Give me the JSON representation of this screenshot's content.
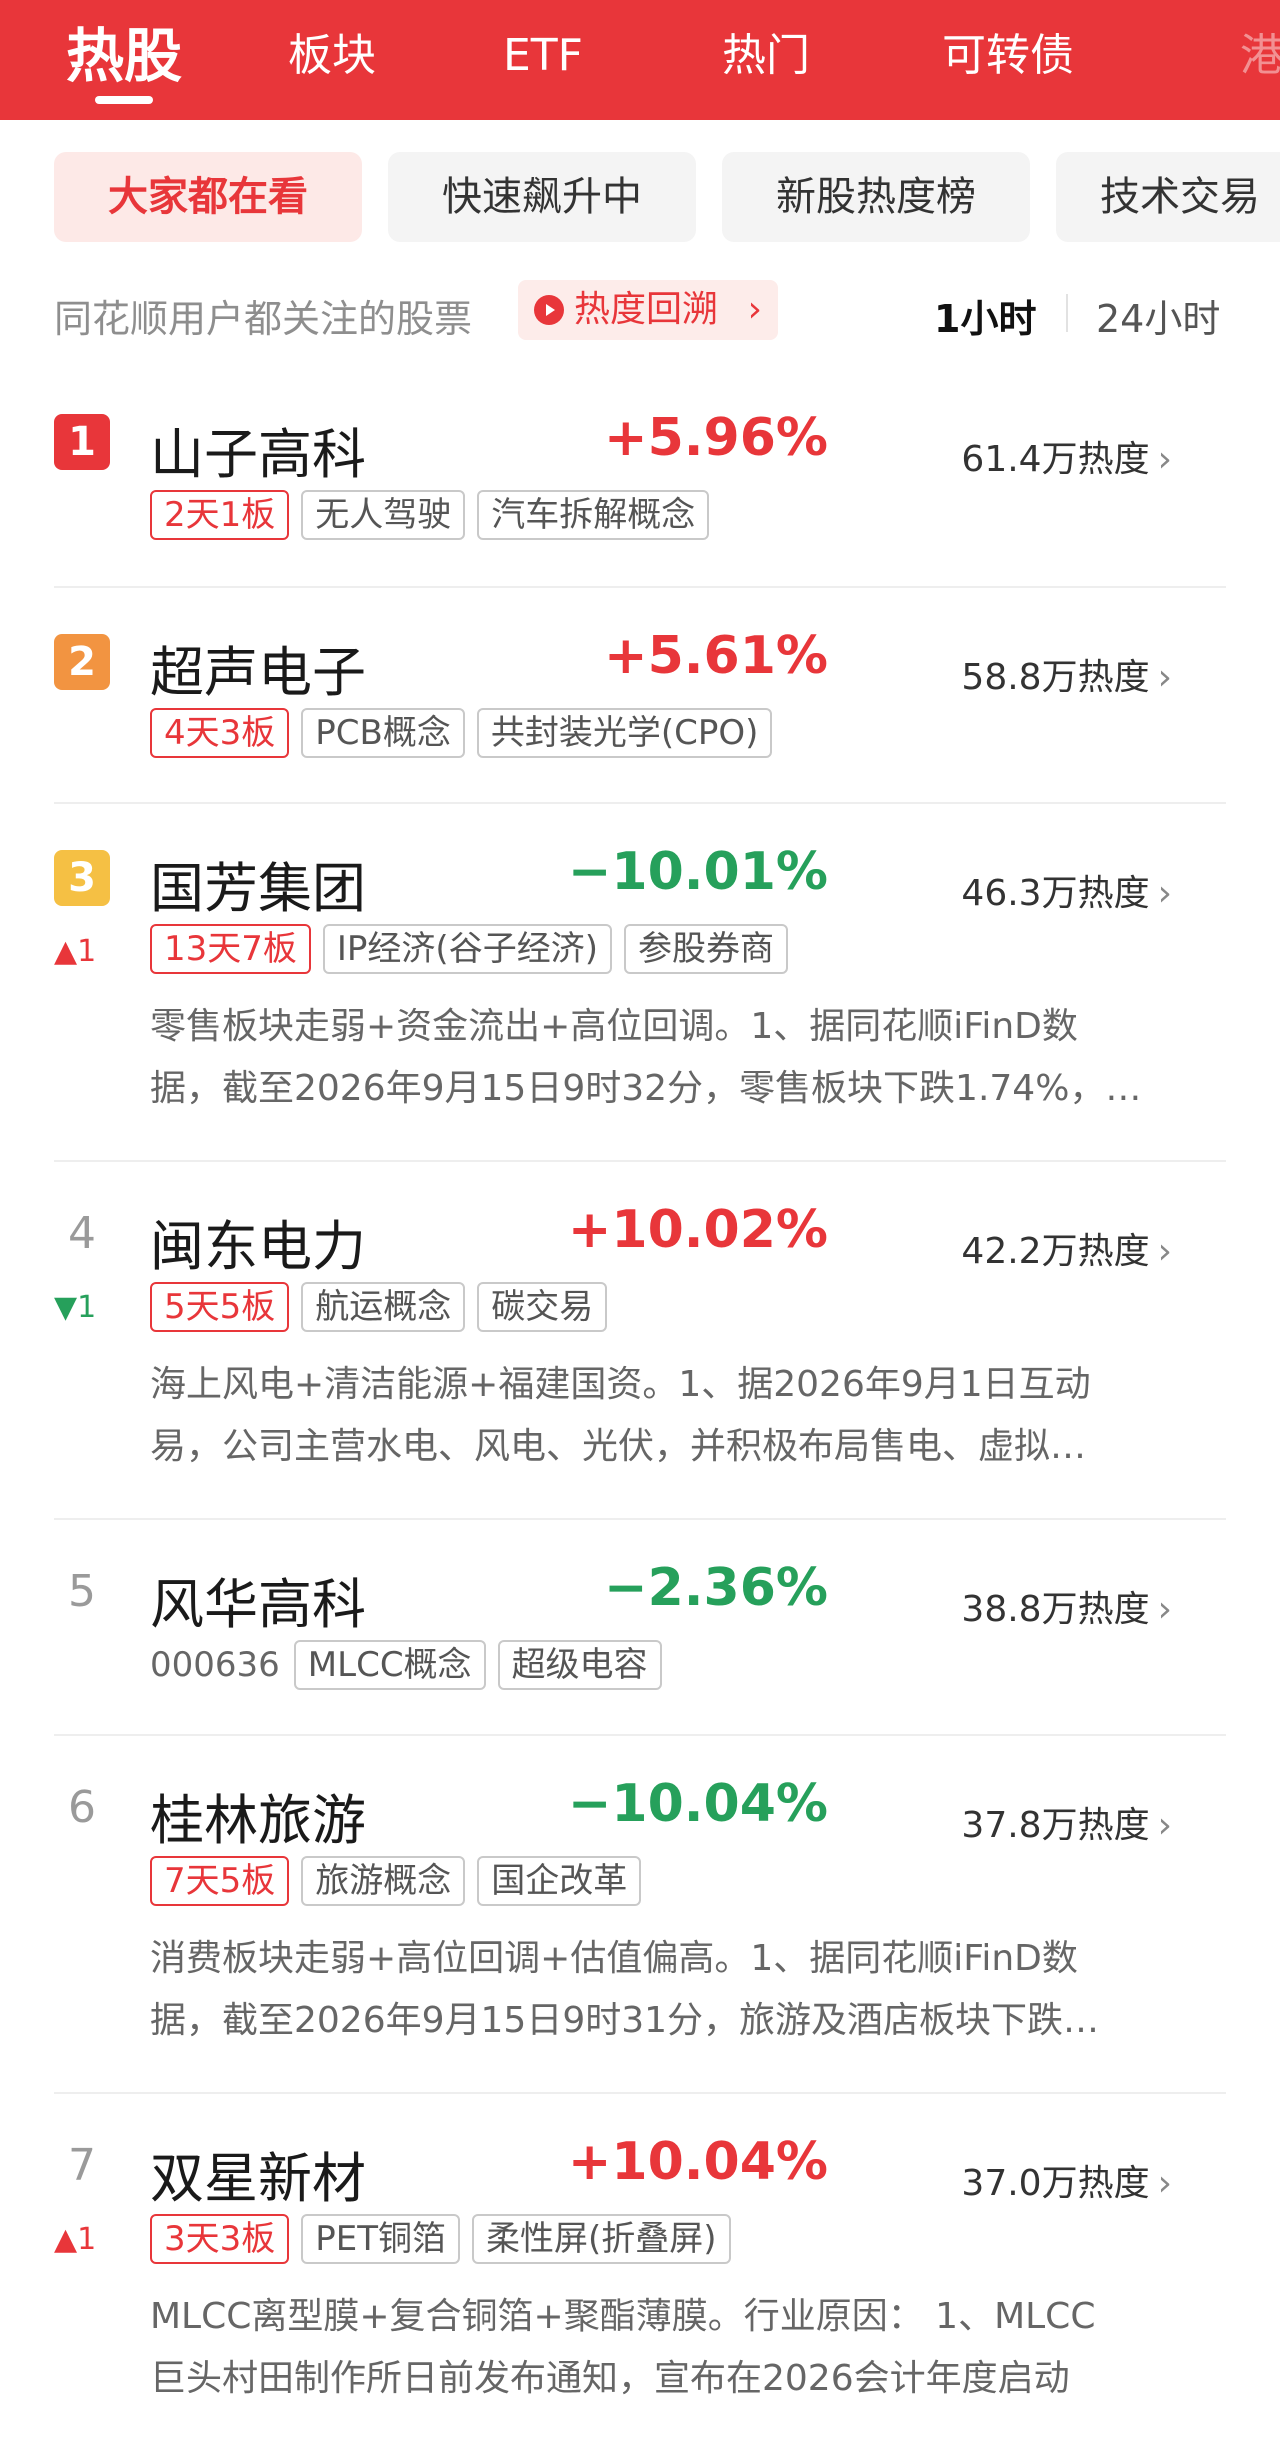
{
  "nav": {
    "tabs": [
      {
        "label": "热股",
        "active": true
      },
      {
        "label": "板块"
      },
      {
        "label": "ETF"
      },
      {
        "label": "热门"
      },
      {
        "label": "可转债"
      },
      {
        "label": "港"
      }
    ]
  },
  "subtabs": [
    "大家都在看",
    "快速飙升中",
    "新股热度榜",
    "技术交易"
  ],
  "info": {
    "text": "同花顺用户都关注的股票",
    "trace_label": "热度回溯",
    "trace_chevron": "›",
    "time_options": [
      "1小时",
      "24小时"
    ]
  },
  "colors": {
    "brand_red": "#e8363a",
    "up": "#e8363a",
    "down": "#26a05b",
    "rank1": "#e8363a",
    "rank2": "#f29441",
    "rank3": "#f5c044"
  },
  "stocks": [
    {
      "rank": "1",
      "name": "山子高科",
      "pct": "+5.96%",
      "heat": "61.4万热度",
      "chev": "›",
      "tags": [
        {
          "text": "2天1板",
          "hot": true
        },
        {
          "text": "无人驾驶"
        },
        {
          "text": "汽车拆解概念"
        }
      ]
    },
    {
      "rank": "2",
      "name": "超声电子",
      "pct": "+5.61%",
      "heat": "58.8万热度",
      "chev": "›",
      "tags": [
        {
          "text": "4天3板",
          "hot": true
        },
        {
          "text": "PCB概念"
        },
        {
          "text": "共封装光学(CPO)"
        }
      ]
    },
    {
      "rank": "3",
      "rank_change": "▲1",
      "name": "国芳集团",
      "pct": "−10.01%",
      "heat": "46.3万热度",
      "chev": "›",
      "tags": [
        {
          "text": "13天7板",
          "hot": true
        },
        {
          "text": "IP经济(谷子经济)"
        },
        {
          "text": "参股券商"
        }
      ],
      "desc": [
        "零售板块走弱+资金流出+高位回调。1、据同花顺iFinD数",
        "据，截至2026年9月15日9时32分，零售板块下跌1.74%，…"
      ]
    },
    {
      "rank": "4",
      "rank_change": "▼1",
      "name": "闽东电力",
      "pct": "+10.02%",
      "heat": "42.2万热度",
      "chev": "›",
      "tags": [
        {
          "text": "5天5板",
          "hot": true
        },
        {
          "text": "航运概念"
        },
        {
          "text": "碳交易"
        }
      ],
      "desc": [
        "海上风电+清洁能源+福建国资。1、据2026年9月1日互动",
        "易，公司主营水电、风电、光伏，并积极布局售电、虚拟…"
      ]
    },
    {
      "rank": "5",
      "name": "风华高科",
      "pct": "−2.36%",
      "heat": "38.8万热度",
      "chev": "›",
      "code": "000636",
      "tags": [
        {
          "text": "MLCC概念"
        },
        {
          "text": "超级电容"
        }
      ]
    },
    {
      "rank": "6",
      "name": "桂林旅游",
      "pct": "−10.04%",
      "heat": "37.8万热度",
      "chev": "›",
      "tags": [
        {
          "text": "7天5板",
          "hot": true
        },
        {
          "text": "旅游概念"
        },
        {
          "text": "国企改革"
        }
      ],
      "desc": [
        "消费板块走弱+高位回调+估值偏高。1、据同花顺iFinD数",
        "据，截至2026年9月15日9时31分，旅游及酒店板块下跌…"
      ]
    },
    {
      "rank": "7",
      "rank_change": "▲1",
      "name": "双星新材",
      "pct": "+10.04%",
      "heat": "37.0万热度",
      "chev": "›",
      "tags": [
        {
          "text": "3天3板",
          "hot": true
        },
        {
          "text": "PET铜箔"
        },
        {
          "text": "柔性屏(折叠屏)"
        }
      ],
      "desc": [
        "MLCC离型膜+复合铜箔+聚酯薄膜。行业原因： 1、MLCC",
        "巨头村田制作所日前发布通知，宣布在2026会计年度启动"
      ]
    }
  ]
}
